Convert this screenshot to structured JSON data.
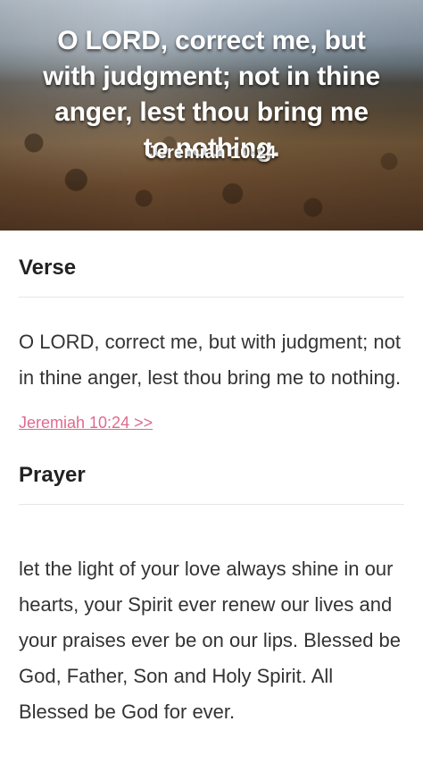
{
  "hero": {
    "quote": "O LORD, correct me, but with judgment; not in thine anger, lest thou bring me to nothing.",
    "reference": "Jeremiah 10:24"
  },
  "verse": {
    "title": "Verse",
    "text": "O LORD, correct me, but with judgment; not in thine anger, lest thou bring me to nothing.",
    "link_label": "Jeremiah 10:24 >>"
  },
  "prayer": {
    "title": "Prayer",
    "text": "let the light of your love always shine in our hearts, your Spirit ever renew our lives and your praises ever be on our lips. Blessed be God, Father, Son and Holy Spirit. All Blessed be God for ever."
  },
  "colors": {
    "accent_link": "#e06a8f",
    "title_text": "#222222",
    "body_text": "#333333",
    "divider": "#e6e6e6"
  }
}
